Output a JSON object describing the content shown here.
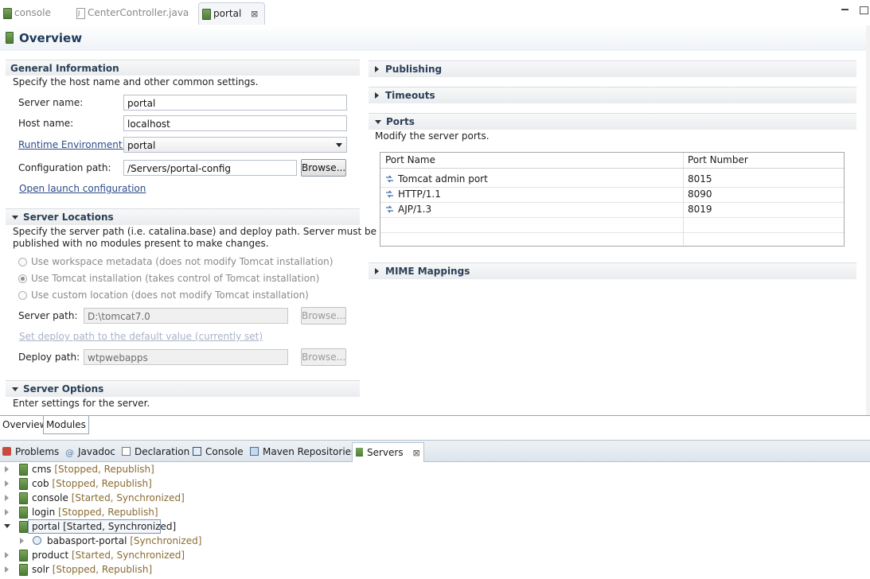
{
  "editor_tabs": [
    {
      "label": "console"
    },
    {
      "label": "CenterController.java"
    },
    {
      "label": "portal",
      "close": "⊠"
    }
  ],
  "overview": {
    "title": "Overview"
  },
  "general": {
    "title": "General Information",
    "description": "Specify the host name and other common settings.",
    "server_name_label": "Server name:",
    "server_name_value": "portal",
    "host_name_label": "Host name:",
    "host_name_value": "localhost",
    "runtime_label": "Runtime Environment:",
    "runtime_value": "portal",
    "config_label": "Configuration path:",
    "config_value": "/Servers/portal-config",
    "browse_label": "Browse...",
    "launch_link": "Open launch configuration"
  },
  "locations": {
    "title": "Server Locations",
    "description_line1": "Specify the server path (i.e. catalina.base) and deploy path. Server must be",
    "description_line2": "published with no modules present to make changes.",
    "options": [
      {
        "label": "Use workspace metadata (does not modify Tomcat installation)",
        "checked": false
      },
      {
        "label": "Use Tomcat installation (takes control of Tomcat installation)",
        "checked": true
      },
      {
        "label": "Use custom location (does not modify Tomcat installation)",
        "checked": false
      }
    ],
    "server_path_label": "Server path:",
    "server_path_value": "D:\\tomcat7.0",
    "browse_label": "Browse...",
    "default_link": "Set deploy path to the default value (currently set)",
    "deploy_path_label": "Deploy path:",
    "deploy_path_value": "wtpwebapps"
  },
  "options_section": {
    "title": "Server Options",
    "description": "Enter settings for the server."
  },
  "right_sections": {
    "publishing": "Publishing",
    "timeouts": "Timeouts",
    "ports": "Ports",
    "ports_description": "Modify the server ports.",
    "mime": "MIME Mappings"
  },
  "ports_table": {
    "headers": [
      "Port Name",
      "Port Number"
    ],
    "rows": [
      {
        "name": "Tomcat admin port",
        "number": "8015"
      },
      {
        "name": "HTTP/1.1",
        "number": "8090"
      },
      {
        "name": "AJP/1.3",
        "number": "8019"
      }
    ]
  },
  "page_tabs": [
    {
      "label": "Overview"
    },
    {
      "label": "Modules"
    }
  ],
  "view_tabs": [
    {
      "label": "Problems"
    },
    {
      "label": "Javadoc"
    },
    {
      "label": "Declaration"
    },
    {
      "label": "Console"
    },
    {
      "label": "Maven Repositories"
    },
    {
      "label": "Servers",
      "close": "⊠"
    }
  ],
  "servers": [
    {
      "name": "cms",
      "status": "[Stopped, Republish]"
    },
    {
      "name": "cob",
      "status": "[Stopped, Republish]"
    },
    {
      "name": "console",
      "status": "[Started, Synchronized]"
    },
    {
      "name": "login",
      "status": "[Stopped, Republish]"
    },
    {
      "name": "portal",
      "status": "[Started, Synchronized]"
    },
    {
      "name": "babasport-portal",
      "status": "[Synchronized]"
    },
    {
      "name": "product",
      "status": "[Started, Synchronized]"
    },
    {
      "name": "solr",
      "status": "[Stopped, Republish]"
    }
  ],
  "colors": {
    "accent_title": "#1f3a5a",
    "status_text": "#8a6b33",
    "link": "#2b4b8a"
  }
}
